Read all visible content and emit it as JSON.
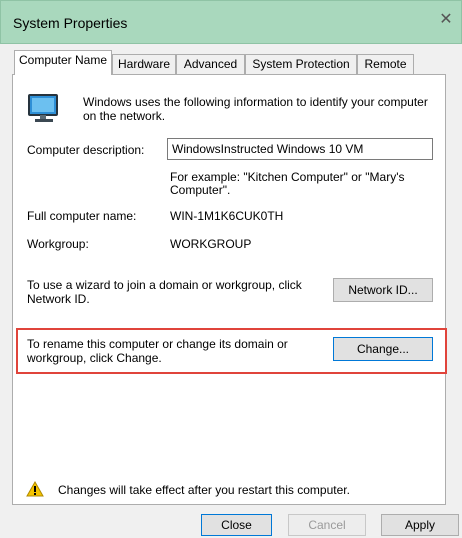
{
  "window": {
    "title": "System Properties",
    "close_glyph": "✕"
  },
  "tabs": [
    {
      "label": "Computer Name",
      "active": true
    },
    {
      "label": "Hardware",
      "active": false
    },
    {
      "label": "Advanced",
      "active": false
    },
    {
      "label": "System Protection",
      "active": false
    },
    {
      "label": "Remote",
      "active": false
    }
  ],
  "intro": {
    "icon": "computer-monitor-icon",
    "line1": "Windows uses the following information to identify your computer",
    "line2": "on the network."
  },
  "description": {
    "label": "Computer description:",
    "value": "WindowsInstructed Windows 10 VM",
    "hint_line1": "For example: \"Kitchen Computer\" or \"Mary's",
    "hint_line2": "Computer\"."
  },
  "full_name": {
    "label": "Full computer name:",
    "value": "WIN-1M1K6CUK0TH"
  },
  "workgroup": {
    "label": "Workgroup:",
    "value": "WORKGROUP"
  },
  "network_id": {
    "line1": "To use a wizard to join a domain or workgroup, click",
    "line2": "Network ID.",
    "button": "Network ID..."
  },
  "rename": {
    "line1": "To rename this computer or change its domain or",
    "line2": "workgroup, click Change.",
    "button": "Change..."
  },
  "notice": {
    "icon": "warning-icon",
    "text": "Changes will take effect after you restart this computer."
  },
  "footer": {
    "close": "Close",
    "cancel": "Cancel",
    "apply": "Apply"
  },
  "colors": {
    "titlebar": "#a9d8bd",
    "highlight": "#e0443b",
    "warning": "#f5c400"
  }
}
